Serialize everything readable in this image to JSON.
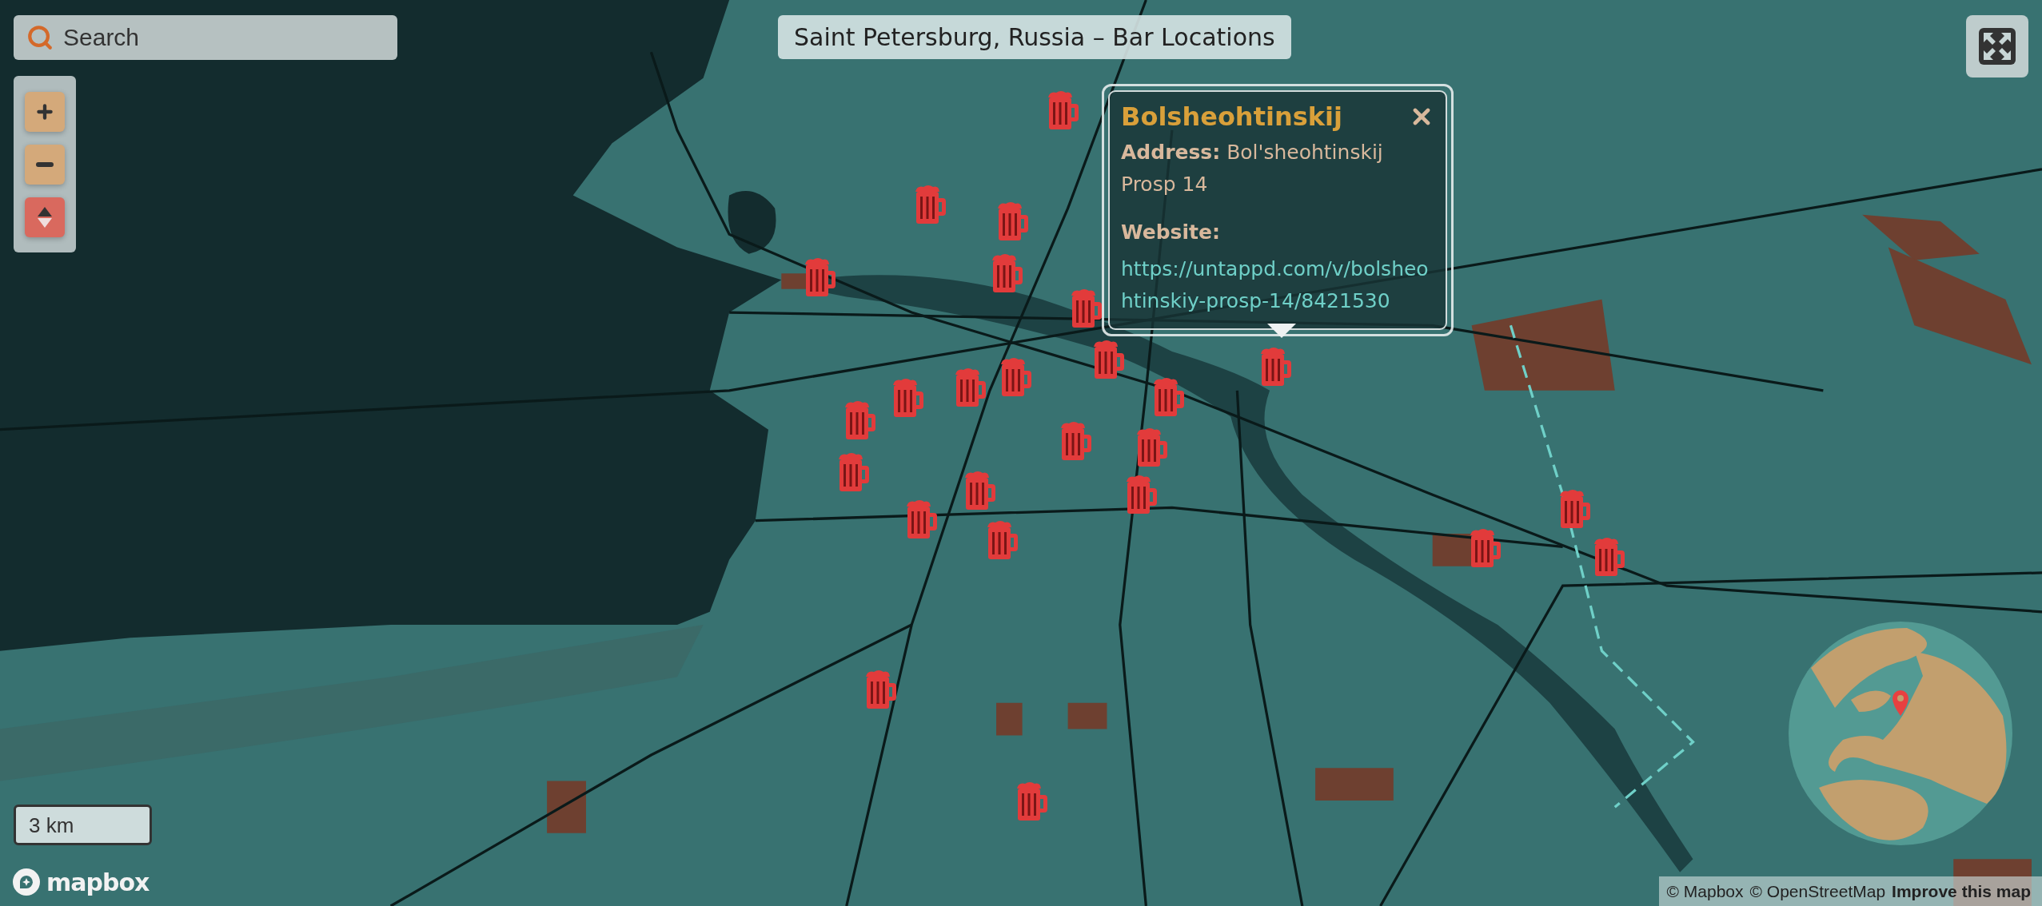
{
  "search": {
    "placeholder": "Search"
  },
  "title": "Saint Petersburg, Russia – Bar Locations",
  "popup": {
    "title": "Bolsheohtinskij",
    "address": "**Address:** Bol'sheohtinskij Prosp 14",
    "website_label": "Website:",
    "website": "https://untappd.com/v/bolsheohtinskiy-prosp-14/8421530"
  },
  "scale": "3 km",
  "logo": "mapbox",
  "attribution": [
    {
      "text": "© Mapbox",
      "kind": "plain"
    },
    {
      "text": "© OpenStreetMap",
      "kind": "plain"
    },
    {
      "text": "Improve this map",
      "kind": "strong"
    }
  ]
}
